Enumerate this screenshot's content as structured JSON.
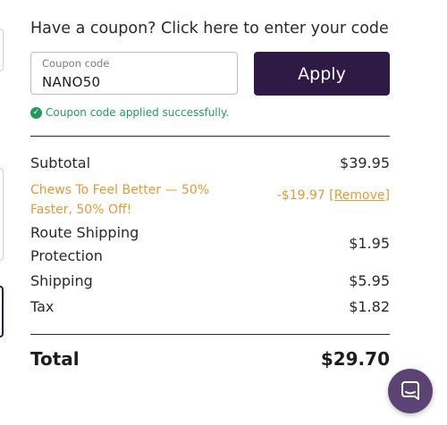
{
  "coupon": {
    "prompt": "Have a coupon? Click here to enter your code",
    "field_label": "Coupon code",
    "field_value": "NANO50",
    "apply_label": "Apply",
    "success_message": "Coupon code applied successfully."
  },
  "summary": {
    "subtotal_label": "Subtotal",
    "subtotal_value": "$39.95",
    "discount_label": "Chews To Feel Better — 50% Faster, 50% Off!",
    "discount_value": "-$19.97",
    "remove_label": "[Remove]",
    "route_label": "Route Shipping Protection",
    "route_value": "$1.95",
    "shipping_label": "Shipping",
    "shipping_value": "$5.95",
    "tax_label": "Tax",
    "tax_value": "$1.82",
    "total_label": "Total",
    "total_value": "$29.70"
  },
  "colors": {
    "accent": "#2f1a45",
    "success": "#1e9d5b",
    "discount": "#e29a35",
    "chat_button": "#5b4473"
  },
  "icons": {
    "success": "check-circle-icon",
    "chat": "chat-bubble-icon"
  }
}
